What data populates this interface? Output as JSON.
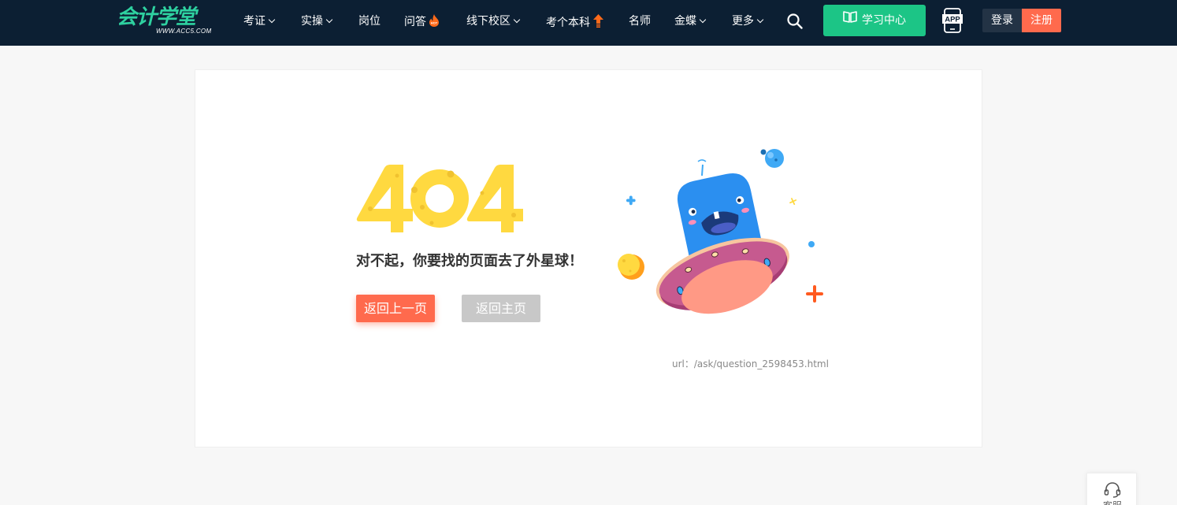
{
  "header": {
    "logo_cn": "会计学堂",
    "logo_en": "WWW.ACC5.COM",
    "nav": [
      {
        "label": "考证",
        "dropdown": true
      },
      {
        "label": "实操",
        "dropdown": true
      },
      {
        "label": "岗位",
        "dropdown": false
      },
      {
        "label": "问答",
        "dropdown": false,
        "badge_icon": "hot-flame-icon"
      },
      {
        "label": "线下校区",
        "dropdown": true
      },
      {
        "label": "考个本科",
        "dropdown": false,
        "badge_icon": "up-arrow-icon"
      },
      {
        "label": "名师",
        "dropdown": false
      },
      {
        "label": "金蝶",
        "dropdown": true
      },
      {
        "label": "更多",
        "dropdown": true
      }
    ],
    "search_icon": "search-icon",
    "study_center_label": "学习中心",
    "app_label": "APP",
    "login_label": "登录",
    "register_label": "注册"
  },
  "error": {
    "code": "404",
    "message": "对不起，你要找的页面去了外星球！",
    "back_label": "返回上一页",
    "home_label": "返回主页",
    "url_text": "url：/ask/question_2598453.html"
  },
  "service": {
    "label": "客服"
  },
  "colors": {
    "header_bg": "#0c1f33",
    "brand_green": "#1cc586",
    "accent_orange": "#ff6a4d",
    "error_yellow": "#ffd940"
  }
}
